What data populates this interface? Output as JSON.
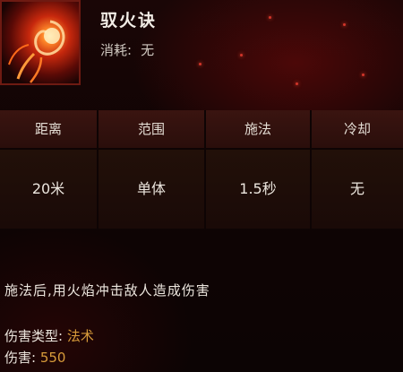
{
  "skill": {
    "name": "驭火诀",
    "cost_label": "消耗:",
    "cost_value": "无",
    "icon": "fire-spirit-icon"
  },
  "stats": [
    {
      "label": "距离",
      "value": "20米"
    },
    {
      "label": "范围",
      "value": "单体"
    },
    {
      "label": "施法",
      "value": "1.5秒"
    },
    {
      "label": "冷却",
      "value": "无"
    }
  ],
  "description": "施法后,用火焰冲击敌人造成伤害",
  "damage_type": {
    "label": "伤害类型:",
    "value": "法术"
  },
  "damage": {
    "label": "伤害:",
    "value": "550"
  },
  "colors": {
    "accent": "#d79b3a",
    "panel": "#2a0e0b",
    "background": "#100404"
  }
}
